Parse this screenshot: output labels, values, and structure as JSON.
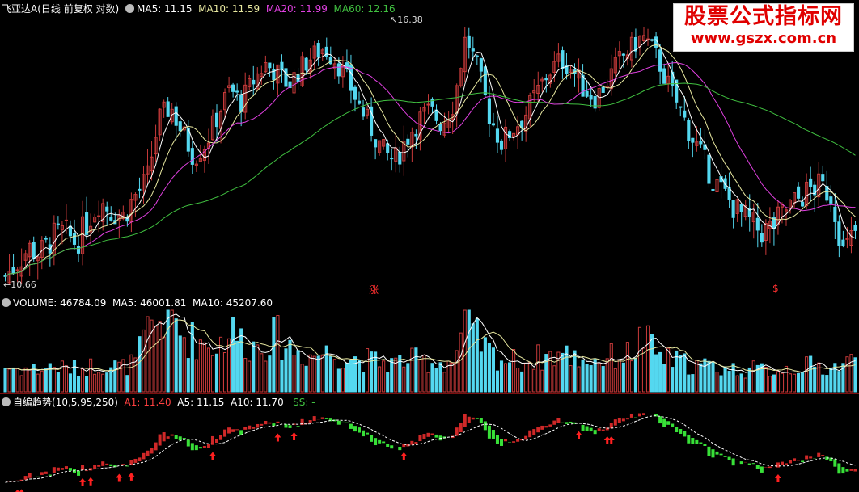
{
  "panels": {
    "price": {
      "title": "飞亚达A",
      "subtitle": "(日线 前复权 对数)",
      "indicators": [
        {
          "label": "MA5:",
          "value": "11.15",
          "color": "#ffffff"
        },
        {
          "label": "MA10:",
          "value": "11.59",
          "color": "#e8e8a0"
        },
        {
          "label": "MA20:",
          "value": "11.99",
          "color": "#e040e0"
        },
        {
          "label": "MA60:",
          "value": "12.16",
          "color": "#40c040"
        }
      ],
      "high_label": "16.38",
      "low_label": "10.66",
      "markers": [
        "涨",
        "$"
      ]
    },
    "volume": {
      "title": "VOLUME:",
      "indicators": [
        {
          "label": "VOLUME:",
          "value": "46784.09",
          "color": "#ffffff"
        },
        {
          "label": "MA5:",
          "value": "46001.81",
          "color": "#ffffff"
        },
        {
          "label": "MA10:",
          "value": "45207.60",
          "color": "#ffffff"
        }
      ]
    },
    "trend": {
      "title": "自编趋势",
      "params": "(10,5,95,250)",
      "indicators": [
        {
          "label": "A1:",
          "value": "11.40",
          "color": "#ff4040"
        },
        {
          "label": "A5:",
          "value": "11.15",
          "color": "#ffffff"
        },
        {
          "label": "A10:",
          "value": "11.70",
          "color": "#ffffff"
        },
        {
          "label": "SS:",
          "value": "-",
          "color": "#40c040"
        }
      ]
    }
  },
  "watermark": {
    "line1": "股票公式指标网",
    "line2": "www.gszx.com.cn"
  },
  "colors": {
    "up": "#c83a3a",
    "down": "#54d8f0",
    "bg": "#000000",
    "ma5": "#ffffff",
    "ma10": "#e8e8a0",
    "ma20": "#e040e0",
    "ma60": "#40c040",
    "trend_up": "#d02828",
    "trend_down": "#38e038",
    "arrow": "#ff2020"
  },
  "chart_data": {
    "type": "candlestick",
    "scale": "log",
    "ylim": [
      10.66,
      16.38
    ],
    "close_path": [
      10.8,
      11.05,
      11.3,
      11.2,
      11.5,
      11.6,
      11.4,
      11.8,
      12.2,
      12.0,
      11.9,
      12.3,
      12.6,
      13.9,
      14.2,
      13.6,
      13.1,
      13.4,
      14.0,
      14.6,
      14.3,
      14.8,
      15.2,
      15.0,
      14.7,
      15.1,
      15.4,
      15.6,
      15.3,
      14.8,
      14.2,
      13.7,
      13.2,
      13.0,
      13.5,
      13.9,
      14.1,
      13.8,
      14.3,
      15.9,
      15.1,
      14.0,
      13.4,
      13.7,
      14.0,
      14.5,
      15.0,
      15.3,
      15.1,
      14.6,
      14.4,
      14.8,
      15.3,
      15.6,
      15.9,
      15.5,
      14.8,
      14.2,
      13.6,
      13.1,
      12.6,
      12.3,
      12.0,
      11.8,
      11.6,
      11.7,
      12.0,
      12.2,
      12.4,
      12.5,
      12.3,
      11.2,
      11.6
    ],
    "volume_path": [
      38,
      36,
      35,
      34,
      40,
      36,
      35,
      38,
      42,
      40,
      38,
      45,
      90,
      110,
      120,
      85,
      80,
      75,
      70,
      95,
      80,
      70,
      78,
      85,
      70,
      60,
      55,
      60,
      58,
      52,
      50,
      48,
      45,
      44,
      50,
      48,
      46,
      45,
      48,
      105,
      80,
      60,
      50,
      48,
      46,
      52,
      55,
      58,
      54,
      50,
      48,
      52,
      56,
      58,
      85,
      60,
      50,
      46,
      42,
      40,
      38,
      36,
      34,
      35,
      33,
      34,
      36,
      38,
      40,
      38,
      36,
      45,
      47
    ]
  }
}
